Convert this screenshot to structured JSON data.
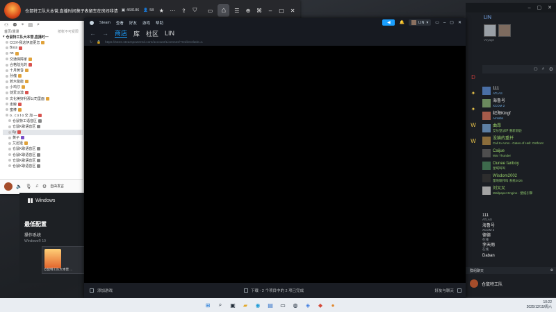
{
  "chat": {
    "title": "仓鼠特工队大本营,直播时间莫子表留车在房间非请勿入",
    "id_count": "468186",
    "online": "58",
    "nav_left": "首页/漫漫",
    "nav_right": "按帐不可受限",
    "channel": "仓鼠特工队大本营,直播时一",
    "users": [
      {
        "name": "CCtV-我这伊虚更怎",
        "badge": "#e0a23a"
      },
      {
        "name": "Boss",
        "badge": "#d9534f"
      },
      {
        "name": "nn",
        "badge": "#e0a23a"
      },
      {
        "name": "交通保障家",
        "badge": "#e0a23a"
      },
      {
        "name": "合格陆光的",
        "badge": "#d9534f"
      },
      {
        "name": "十月黄昏",
        "badge": "#e0a23a"
      },
      {
        "name": "孙傀",
        "badge": "#e0a23a"
      },
      {
        "name": "若木能能",
        "badge": "#e0a23a"
      },
      {
        "name": "小鸡仔",
        "badge": "#e0a23a"
      },
      {
        "name": "徒爱淡漠",
        "badge": "#d9534f"
      },
      {
        "name": "文化美好利那公司里面",
        "badge": "#e0a23a"
      },
      {
        "name": "走鲸",
        "badge": "#d9534f"
      },
      {
        "name": "蜜棒",
        "badge": "#e0a23a"
      },
      {
        "name": "o . c s t o 交 加 —",
        "badge": "#d9534f"
      },
      {
        "name": "仓鼠特工语音区",
        "badge": "#888888"
      },
      {
        "name": "仓鼠K歌语音区",
        "badge": "#888888"
      },
      {
        "name": "6y",
        "badge": "#d9534f"
      },
      {
        "name": "黄子",
        "badge": "#7a4fc9"
      },
      {
        "name": "艾尼娅",
        "badge": "#e0a23a"
      },
      {
        "name": "仓鼠K歌语音区",
        "badge": "#888888"
      },
      {
        "name": "仓鼠K歌语音区",
        "badge": "#888888"
      },
      {
        "name": "仓鼠K歌语音区",
        "badge": "#888888"
      },
      {
        "name": "仓鼠K歌语音区",
        "badge": "#888888"
      }
    ],
    "say_label": "自由发言"
  },
  "sysinfo": {
    "windows_label": "Windows",
    "heading": "最低配置",
    "os_key": "操作系统",
    "os_value": "Windows® 10",
    "thumb_label": "仓鼠特工队大本营 ..."
  },
  "steam": {
    "menu": [
      "Steam",
      "查看",
      "好友",
      "游戏",
      "帮助"
    ],
    "user": "LIN",
    "nav": [
      "商店",
      "库",
      "社区",
      "LIN"
    ],
    "url": "https://store.steampowered.com/account/Licenses/?redirectlatin=1",
    "add_game": "添加游戏",
    "downloads": "下载 - 2 个项目中的 2 项已完成",
    "friends_chat": "好友与聊天"
  },
  "friends": {
    "user_name": "LIN",
    "user_status": "Voyage",
    "list": [
      {
        "name": "111",
        "game": "ATLAS",
        "color": "#4a6fa5",
        "online": false
      },
      {
        "name": "海鲁号",
        "game": "XCOM 2",
        "color": "#6b8a5e",
        "online": false
      },
      {
        "name": "纪海Kingf",
        "game": "Amtabs",
        "color": "#a55b4a",
        "online": false
      },
      {
        "name": "曲昂",
        "game": "艾尔登法环 重新测验",
        "color": "#5d7fa3",
        "online": true
      },
      {
        "name": "没猫的重扦",
        "game": "Call to Arms - Gates of Hell: Ostfront",
        "color": "#8b6d3b",
        "online": true
      },
      {
        "name": "Caijue",
        "game": "War Thunder",
        "color": "#4e4e4e",
        "online": true
      },
      {
        "name": "Ounee fanboy",
        "game": "星域叫叫",
        "color": "#3d6a4c",
        "online": true
      },
      {
        "name": "Wisdom2002",
        "game": "量地联邦叫 系统2026",
        "color": "#2d2d2d",
        "online": true
      },
      {
        "name": "刘又又",
        "game": "Wallpaper Engine · 壁纸引擎",
        "color": "#a3a3a3",
        "online": true
      }
    ],
    "list2": [
      {
        "name": "111",
        "game": "ATLAS"
      },
      {
        "name": "海鲁号",
        "game": "XCOM 2"
      },
      {
        "name": "德德",
        "game": "在线"
      },
      {
        "name": "李天雨",
        "game": "在线"
      },
      {
        "name": "Daban",
        "game": ""
      }
    ],
    "group_bar": "群组聊天",
    "group_name": "仓鼠特工队"
  },
  "taskbar": {
    "time": "10:22",
    "date": "2025/12/15/周六"
  },
  "colors": {
    "steam_blue": "#1a9fff",
    "online_green": "#9ad36a"
  }
}
